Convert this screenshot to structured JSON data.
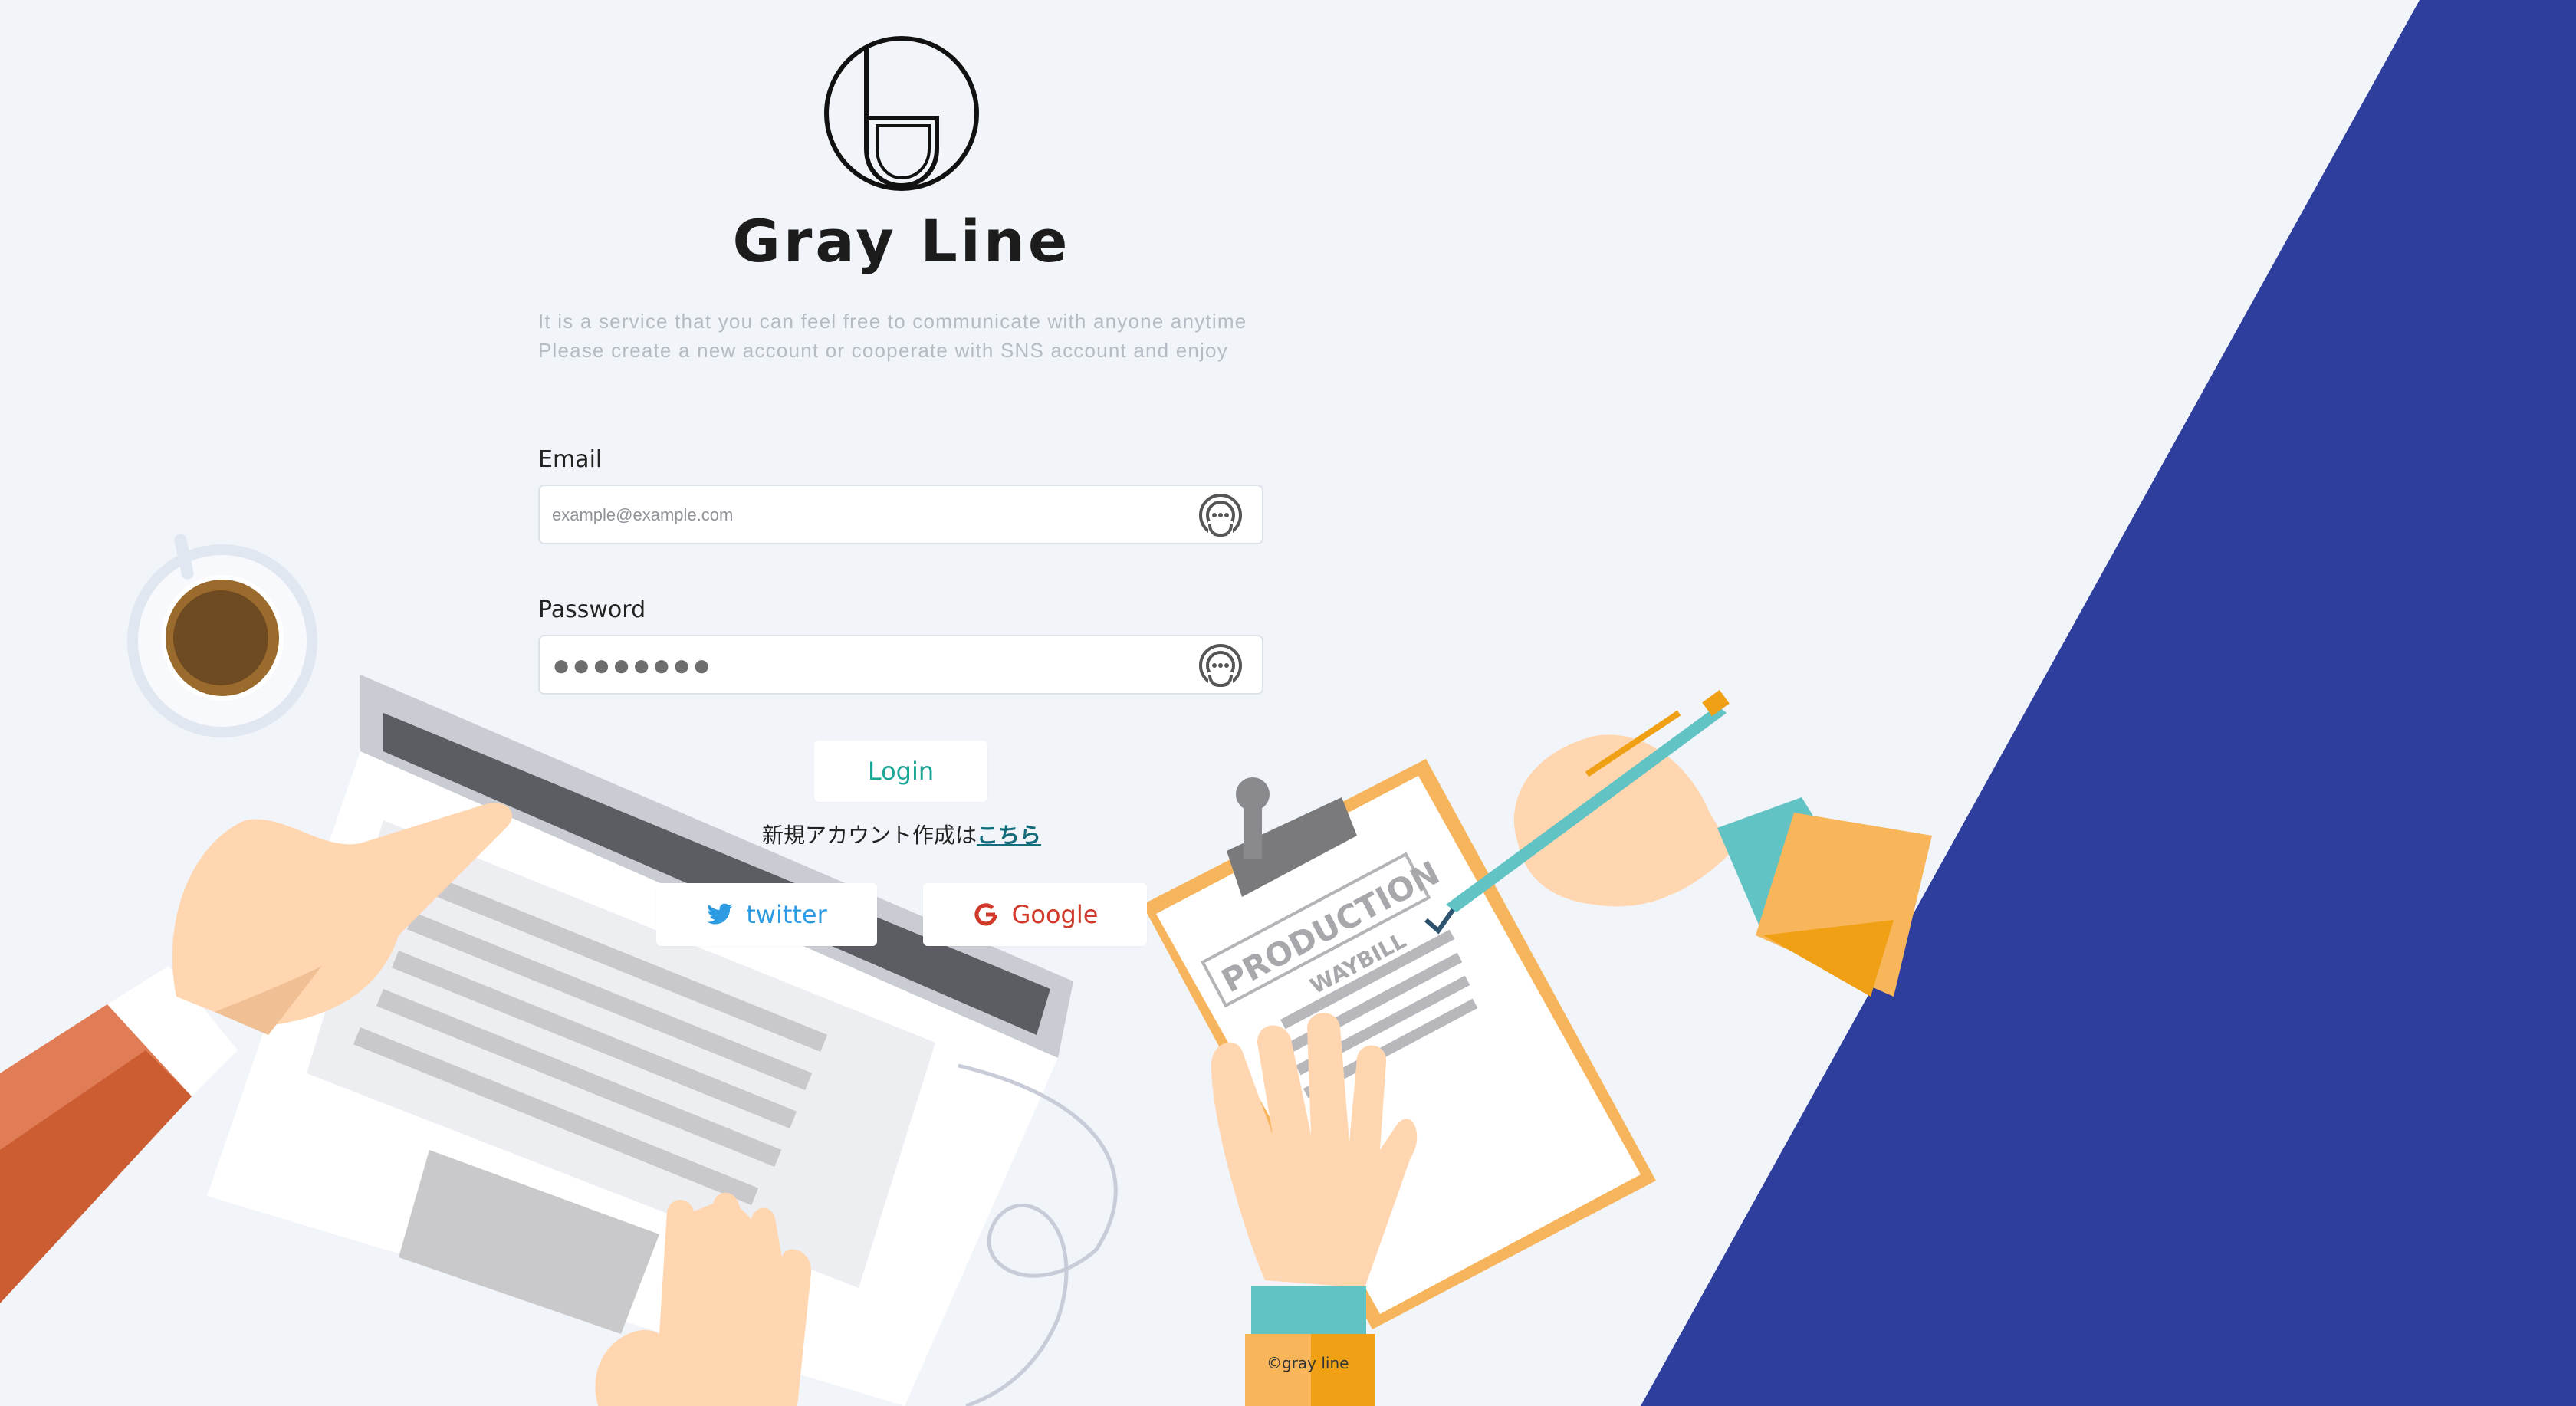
{
  "app": {
    "brand_name": "Gray Line",
    "tagline_line1": "It is a service that you can feel free to communicate with anyone anytime",
    "tagline_line2": "Please create a new account or cooperate with SNS account and enjoy"
  },
  "form": {
    "email_label": "Email",
    "email_placeholder": "example@example.com",
    "password_label": "Password",
    "password_value": "●●●●●●●●",
    "login_label": "Login",
    "signup_text": "新規アカウント作成は",
    "signup_link": "こちら"
  },
  "social": {
    "twitter_label": "twitter",
    "google_label": "Google"
  },
  "footer": {
    "copyright": "©gray line"
  },
  "icons": {
    "logo": "gray-line-logo-icon",
    "field_action": "password-manager-icon",
    "twitter": "twitter-bird-icon",
    "google": "google-g-icon"
  },
  "colors": {
    "background": "#f1f4f9",
    "accent_navy": "#2e3e9c",
    "login_text": "#1aa697",
    "twitter": "#2d9be2",
    "google": "#d13a2b"
  }
}
